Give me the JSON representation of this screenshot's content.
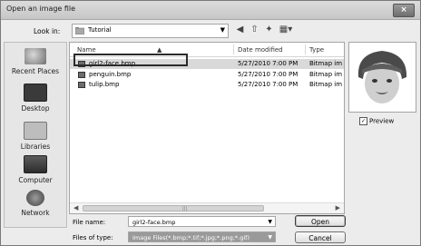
{
  "window": {
    "title": "Open an image file",
    "close_label": "×"
  },
  "toolbar": {
    "look_in_label": "Look in:",
    "look_in_value": "Tutorial"
  },
  "places": [
    {
      "label": "Recent Places",
      "icon": "recent-places-icon"
    },
    {
      "label": "Desktop",
      "icon": "desktop-icon"
    },
    {
      "label": "Libraries",
      "icon": "libraries-icon"
    },
    {
      "label": "Computer",
      "icon": "computer-icon"
    },
    {
      "label": "Network",
      "icon": "network-icon"
    }
  ],
  "file_list": {
    "columns": [
      "Name",
      "Date modified",
      "Type"
    ],
    "rows": [
      {
        "name": "girl2-face.bmp",
        "date": "5/27/2010 7:00 PM",
        "type": "Bitmap im",
        "selected": true
      },
      {
        "name": "penguin.bmp",
        "date": "5/27/2010 7:00 PM",
        "type": "Bitmap im",
        "selected": false
      },
      {
        "name": "tulip.bmp",
        "date": "5/27/2010 7:00 PM",
        "type": "Bitmap im",
        "selected": false
      }
    ]
  },
  "preview": {
    "checkbox_label": "Preview",
    "checked": true
  },
  "footer": {
    "file_name_label": "File name:",
    "file_name_value": "girl2-face.bmp",
    "file_type_label": "Files of type:",
    "file_type_value": "Image Files(*.bmp;*.tif;*.jpg;*.png;*.gif)",
    "open_label": "Open",
    "cancel_label": "Cancel"
  }
}
